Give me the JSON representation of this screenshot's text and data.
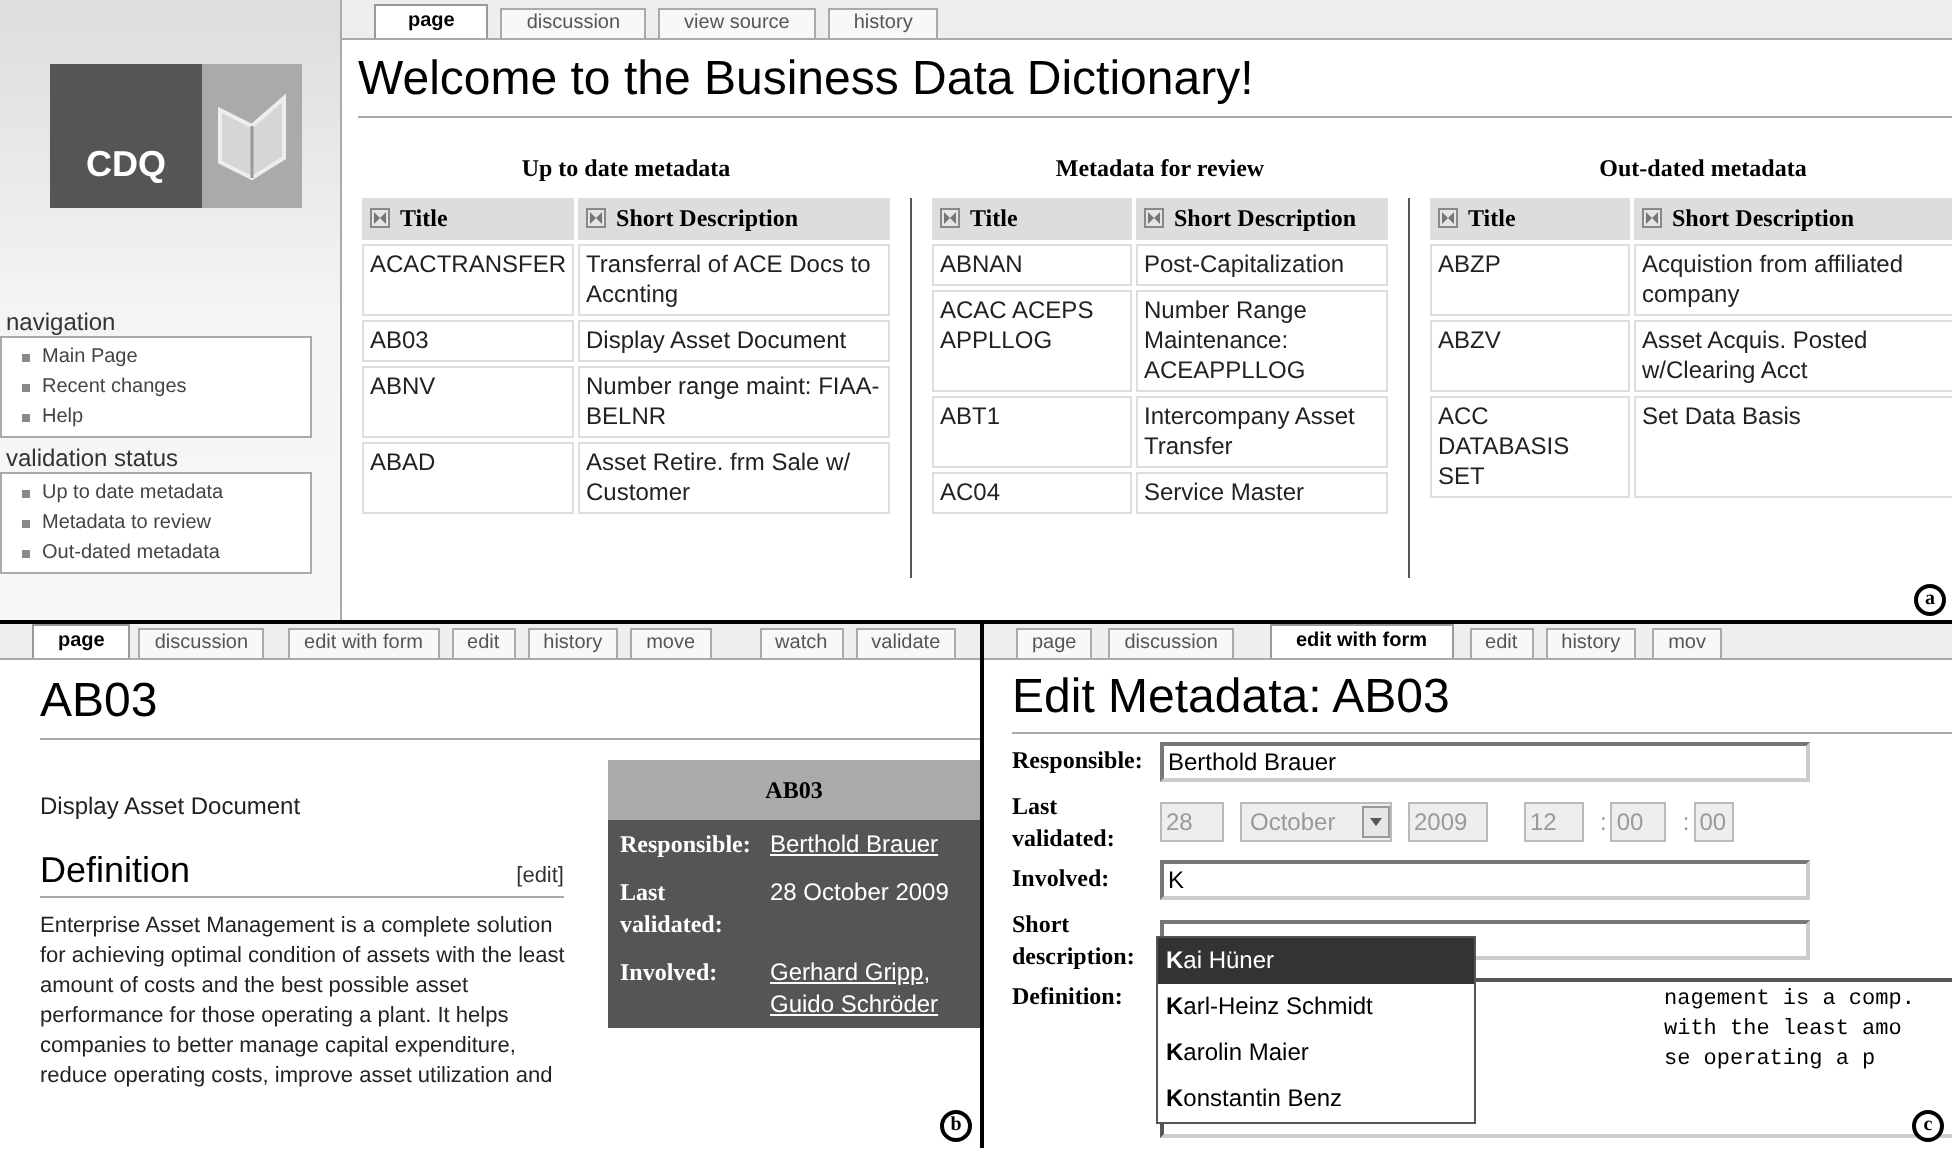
{
  "panel_a": {
    "tabs": [
      {
        "label": "page",
        "selected": true
      },
      {
        "label": "discussion",
        "selected": false
      },
      {
        "label": "view source",
        "selected": false
      },
      {
        "label": "history",
        "selected": false
      }
    ],
    "logo_text": "CDQ",
    "sidebar": [
      {
        "heading": "navigation",
        "items": [
          "Main Page",
          "Recent changes",
          "Help"
        ]
      },
      {
        "heading": "validation status",
        "items": [
          "Up to date metadata",
          "Metadata to review",
          "Out-dated metadata"
        ]
      }
    ],
    "title": "Welcome to the Business Data Dictionary!",
    "tables": [
      {
        "heading": "Up to date metadata",
        "columns": [
          "Title",
          "Short Description"
        ],
        "rows": [
          [
            "ACACTRANSFER",
            "Transferral of ACE Docs to Accnting"
          ],
          [
            "AB03",
            "Display Asset Document"
          ],
          [
            "ABNV",
            "Number range maint: FIAA-BELNR"
          ],
          [
            "ABAD",
            "Asset Retire. frm Sale w/ Customer"
          ]
        ]
      },
      {
        "heading": "Metadata for review",
        "columns": [
          "Title",
          "Short Description"
        ],
        "rows": [
          [
            "ABNAN",
            "Post-Capitalization"
          ],
          [
            "ACAC ACEPS APPLLOG",
            "Number Range Maintenance: ACEAPPLLOG"
          ],
          [
            "ABT1",
            "Intercompany Asset Transfer"
          ],
          [
            "AC04",
            "Service Master"
          ]
        ]
      },
      {
        "heading": "Out-dated metadata",
        "columns": [
          "Title",
          "Short Description"
        ],
        "rows": [
          [
            "ABZP",
            "Acquistion from affiliated company"
          ],
          [
            "ABZV",
            "Asset Acquis. Posted w/Clearing Acct"
          ],
          [
            "ACC DATABASIS SET",
            "Set Data Basis"
          ]
        ]
      }
    ],
    "figure_label": "a"
  },
  "panel_b": {
    "tabs": [
      {
        "label": "page",
        "selected": true
      },
      {
        "label": "discussion",
        "selected": false
      },
      {
        "label": "edit with form",
        "selected": false
      },
      {
        "label": "edit",
        "selected": false
      },
      {
        "label": "history",
        "selected": false
      },
      {
        "label": "move",
        "selected": false
      },
      {
        "label": "watch",
        "selected": false
      },
      {
        "label": "validate",
        "selected": false
      }
    ],
    "title": "AB03",
    "summary": "Display Asset Document",
    "section_heading": "Definition",
    "edit_link": "[edit]",
    "paragraph": "Enterprise Asset Management is a complete solution for achieving optimal condition of assets with the least amount of costs and the best possible asset performance for those operating a plant. It helps companies to better manage capital expenditure, reduce operating costs, improve asset utilization and",
    "infobox": {
      "title": "AB03",
      "rows": [
        {
          "label": "Responsible:",
          "values": [
            {
              "text": "Berthold Brauer",
              "link": true
            }
          ]
        },
        {
          "label": "Last validated:",
          "values": [
            {
              "text": "28 October 2009",
              "link": false
            }
          ]
        },
        {
          "label": "Involved:",
          "values": [
            {
              "text": "Gerhard Gripp",
              "link": true
            },
            {
              "text": "Guido Schröder",
              "link": true
            }
          ]
        }
      ],
      "separator": ","
    },
    "figure_label": "b"
  },
  "panel_c": {
    "tabs": [
      {
        "label": "page",
        "selected": false
      },
      {
        "label": "discussion",
        "selected": false
      },
      {
        "label": "edit with form",
        "selected": true
      },
      {
        "label": "edit",
        "selected": false
      },
      {
        "label": "history",
        "selected": false
      },
      {
        "label": "mov",
        "selected": false
      }
    ],
    "title": "Edit Metadata: AB03",
    "fields": [
      {
        "kind": "text",
        "label": "Responsible:",
        "value": "Berthold Brauer"
      },
      {
        "kind": "datetime",
        "label": "Last validated:",
        "disabled": true,
        "day": "28",
        "month": "October",
        "year": "2009",
        "hour": "12",
        "minute": "00",
        "second": "00",
        "separator": ":"
      },
      {
        "kind": "text",
        "label": "Involved:",
        "value": "K"
      },
      {
        "kind": "text",
        "label": "Short description:"
      },
      {
        "kind": "textarea",
        "label": "Definition:",
        "lines": [
          "nagement is a comp.",
          "with the least amo",
          "se operating a p"
        ]
      }
    ],
    "suggestions": [
      {
        "text": "**K**ai Hüner",
        "selected": true
      },
      {
        "text": "**K**arl-Heinz Schmidt",
        "selected": false
      },
      {
        "text": "**K**arolin Maier",
        "selected": false
      },
      {
        "text": "**K**onstantin Benz",
        "selected": false
      }
    ],
    "figure_label": "c"
  }
}
